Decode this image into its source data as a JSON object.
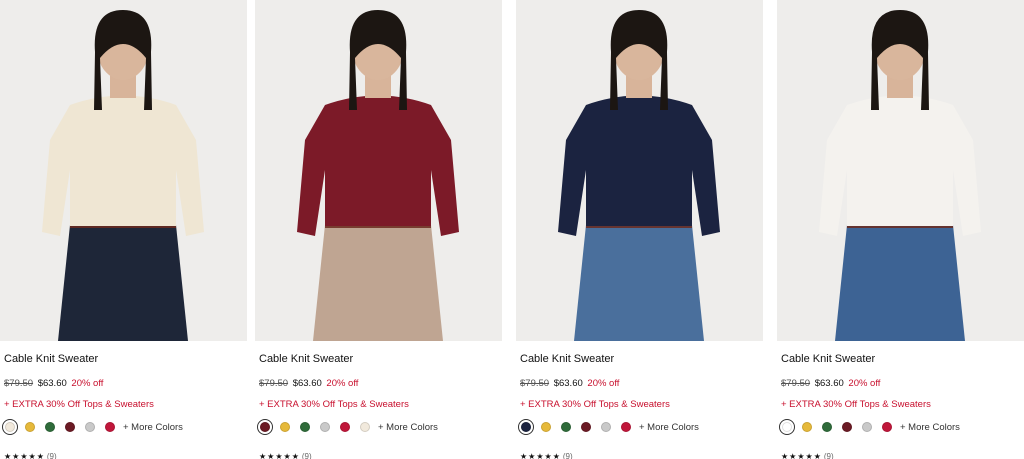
{
  "products": [
    {
      "name": "Cable Knit Sweater",
      "original_price": "$79.50",
      "sale_price": "$63.60",
      "discount": "20% off",
      "promo": "+ EXTRA 30% Off Tops & Sweaters",
      "more_colors": "+ More Colors",
      "stars": "★★★★★",
      "review_count": "(9)",
      "image_alt": "Model wearing cream cable knit sweater with dark jeans",
      "sweater_color": "#efe6d3",
      "bottom_color": "#1e2638",
      "swatches": [
        {
          "color": "#f1e9dc",
          "selected": true
        },
        {
          "color": "#e6b93a",
          "selected": false
        },
        {
          "color": "#2f6b3a",
          "selected": false
        },
        {
          "color": "#6b1a24",
          "selected": false
        },
        {
          "color": "#c9c9c9",
          "selected": false
        },
        {
          "color": "#c0163a",
          "selected": false
        }
      ]
    },
    {
      "name": "Cable Knit Sweater",
      "original_price": "$79.50",
      "sale_price": "$63.60",
      "discount": "20% off",
      "promo": "+ EXTRA 30% Off Tops & Sweaters",
      "more_colors": "+ More Colors",
      "stars": "★★★★★",
      "review_count": "(9)",
      "image_alt": "Model wearing burgundy cable knit sweater with plaid skirt",
      "sweater_color": "#7c1a28",
      "bottom_color": "#bfa592",
      "swatches": [
        {
          "color": "#6b1a24",
          "selected": true
        },
        {
          "color": "#e6b93a",
          "selected": false
        },
        {
          "color": "#2f6b3a",
          "selected": false
        },
        {
          "color": "#c9c9c9",
          "selected": false
        },
        {
          "color": "#c0163a",
          "selected": false
        },
        {
          "color": "#f1e9dc",
          "selected": false
        }
      ]
    },
    {
      "name": "Cable Knit Sweater",
      "original_price": "$79.50",
      "sale_price": "$63.60",
      "discount": "20% off",
      "promo": "+ EXTRA 30% Off Tops & Sweaters",
      "more_colors": "+ More Colors",
      "stars": "★★★★★",
      "review_count": "(9)",
      "image_alt": "Model wearing navy cable knit sweater with blue jeans",
      "sweater_color": "#1b2340",
      "bottom_color": "#4a6f9c",
      "swatches": [
        {
          "color": "#1b2340",
          "selected": true
        },
        {
          "color": "#e6b93a",
          "selected": false
        },
        {
          "color": "#2f6b3a",
          "selected": false
        },
        {
          "color": "#6b1a24",
          "selected": false
        },
        {
          "color": "#c9c9c9",
          "selected": false
        },
        {
          "color": "#c0163a",
          "selected": false
        }
      ]
    },
    {
      "name": "Cable Knit Sweater",
      "original_price": "$79.50",
      "sale_price": "$63.60",
      "discount": "20% off",
      "promo": "+ EXTRA 30% Off Tops & Sweaters",
      "more_colors": "+ More Colors",
      "stars": "★★★★★",
      "review_count": "(9)",
      "image_alt": "Model wearing white cable knit sweater with wide leg jeans",
      "sweater_color": "#f4f2ee",
      "bottom_color": "#3d6394",
      "swatches": [
        {
          "color": "#ffffff",
          "selected": true
        },
        {
          "color": "#e6b93a",
          "selected": false
        },
        {
          "color": "#2f6b3a",
          "selected": false
        },
        {
          "color": "#6b1a24",
          "selected": false
        },
        {
          "color": "#c9c9c9",
          "selected": false
        },
        {
          "color": "#c0163a",
          "selected": false
        }
      ]
    }
  ]
}
